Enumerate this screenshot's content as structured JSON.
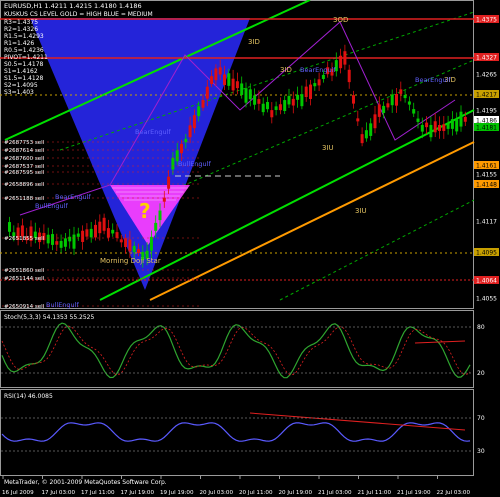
{
  "header": {
    "symbol_line": "EURUSD,H1  1.4211 1.4215 1.4180 1.4186",
    "sub_line": "KUSKUS CS LEVEL GOLD = HIGH  BLUE = MEDIUM"
  },
  "pivots": [
    {
      "label": "R3=1.4375"
    },
    {
      "label": "R2=1.4326"
    },
    {
      "label": "R1.5=1.4293"
    },
    {
      "label": "R1=1.426"
    },
    {
      "label": "R0.5=1.4236"
    },
    {
      "label": "PIVOT=1.4211"
    },
    {
      "label": "S0.5=1.4178"
    },
    {
      "label": "S1=1.4162"
    },
    {
      "label": "S1.5=1.4128"
    },
    {
      "label": "S2=1.4095"
    },
    {
      "label": "S3=1.403"
    }
  ],
  "price_axis": [
    {
      "label": "1.4375",
      "style": "red"
    },
    {
      "label": "1.4327",
      "style": "red"
    },
    {
      "label": "1.4265",
      "style": "plain"
    },
    {
      "label": "1.4217",
      "style": "gold"
    },
    {
      "label": "1.4195",
      "style": "plain"
    },
    {
      "label": "1.4186",
      "style": "white"
    },
    {
      "label": "1.4181",
      "style": "green"
    },
    {
      "label": "1.4161",
      "style": "orange"
    },
    {
      "label": "1.4155",
      "style": "plain"
    },
    {
      "label": "1.4148",
      "style": "orange"
    },
    {
      "label": "1.4117",
      "style": "plain"
    },
    {
      "label": "1.4095",
      "style": "gold"
    },
    {
      "label": "1.4064",
      "style": "red"
    },
    {
      "label": "1.4055",
      "style": "plain"
    }
  ],
  "sell_orders": [
    "#2687753 sell",
    "#2687614 sell",
    "#2687600 sell",
    "#2687537 sell",
    "#2687595 sell",
    "#2658896 sell",
    "#2651188 sell",
    "#2651855 sell",
    "#2651860 sell",
    "#2651144 sell",
    "#2650914 sell"
  ],
  "annotations": {
    "wave_3id_top": "3ID",
    "wave_3od": "3OD",
    "wave_3id_mid": "3ID",
    "wave_3id_right": "3ID",
    "wave_3iu_low": "3IU",
    "wave_3iu_bottom": "3IU",
    "bear_engulf_left": "BearEngulf",
    "bear_engulf_mid": "BearEngulf",
    "bear_engulf_right": "BearEngulf",
    "bull_engulf_1": "BullEngulf",
    "bull_engulf_2": "BullEngulf",
    "bear_engulf_low": "BearEngulf",
    "bull_engulf_bottom": "BullEngulf",
    "morning_doji": "Morning Doji Star",
    "question": "?"
  },
  "stoch": {
    "title": "Stoch(5,3,3) 54.1353 55.2525",
    "axis": [
      "80",
      "20"
    ]
  },
  "rsi": {
    "title": "RSI(14) 46.0085",
    "axis": [
      "70",
      "30"
    ]
  },
  "footer": {
    "copyright": "MetaTrader, © 2001-2009 MetaQuotes Software Corp."
  },
  "time_axis": [
    "16 Jul 2009",
    "17 Jul 03:00",
    "17 Jul 11:00",
    "17 Jul 19:00",
    "19 Jul 19:00",
    "20 Jul 03:00",
    "20 Jul 11:00",
    "20 Jul 19:00",
    "21 Jul 03:00",
    "21 Jul 11:00",
    "21 Jul 19:00",
    "22 Jul 03:00"
  ],
  "colors": {
    "background": "#000000",
    "bull_candle": "#00c800",
    "bear_candle": "#e01010",
    "channel_green": "#00e000",
    "channel_orange": "#ff9a00",
    "wedge_blue": "#2a2aff",
    "triangle_pink": "#ff40ff",
    "stoch_main": "#2fa52f",
    "signal_red": "#e02020",
    "rsi_line": "#5a5aff"
  }
}
